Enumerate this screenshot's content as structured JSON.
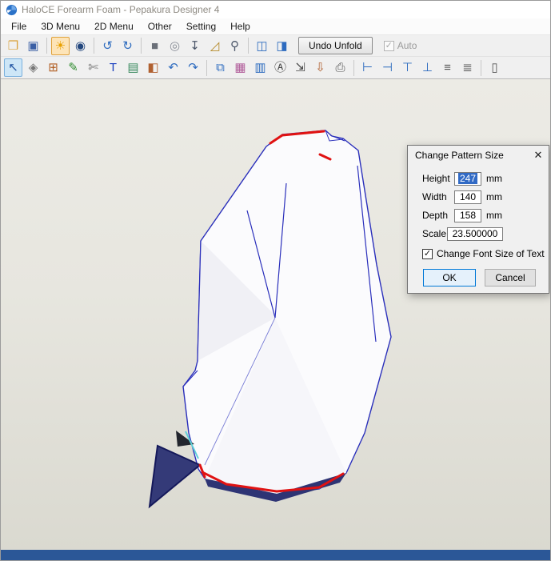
{
  "titlebar": {
    "title": "HaloCE Forearm Foam - Pepakura Designer 4"
  },
  "menubar": {
    "items": [
      {
        "label": "File",
        "name": "menu-file"
      },
      {
        "label": "3D Menu",
        "name": "menu-3d"
      },
      {
        "label": "2D Menu",
        "name": "menu-2d"
      },
      {
        "label": "Other",
        "name": "menu-other"
      },
      {
        "label": "Setting",
        "name": "menu-setting"
      },
      {
        "label": "Help",
        "name": "menu-help"
      }
    ]
  },
  "toolbar1": {
    "icons": [
      {
        "name": "open-folder-icon",
        "glyph": "❒",
        "color": "#d9a23c"
      },
      {
        "name": "save-icon",
        "glyph": "▣",
        "color": "#3a5fa5"
      },
      {
        "sep": true
      },
      {
        "name": "light-toggle-icon",
        "glyph": "☀",
        "color": "#e8a000",
        "cls": "on-orange"
      },
      {
        "name": "texture-view-icon",
        "glyph": "◉",
        "color": "#23477e"
      },
      {
        "sep": true
      },
      {
        "name": "rotate-left-icon",
        "glyph": "↺",
        "color": "#2d6bbf"
      },
      {
        "name": "rotate-right-icon",
        "glyph": "↻",
        "color": "#2d6bbf"
      },
      {
        "sep": true
      },
      {
        "name": "cube-view-icon",
        "glyph": "■",
        "color": "#6a6f78"
      },
      {
        "name": "cylinder-view-icon",
        "glyph": "◎",
        "color": "#8a8f98"
      },
      {
        "name": "plumb-icon",
        "glyph": "↧",
        "color": "#4a5568"
      },
      {
        "name": "ruler-icon",
        "glyph": "◿",
        "color": "#b58a2a"
      },
      {
        "name": "zoom-icon",
        "glyph": "⚲",
        "color": "#4a5568"
      },
      {
        "sep": true
      },
      {
        "name": "split-view-icon",
        "glyph": "◫",
        "color": "#2d6bbf"
      },
      {
        "name": "single-pane-icon",
        "glyph": "◨",
        "color": "#2d6bbf"
      }
    ],
    "button": {
      "label": "Undo Unfold"
    },
    "auto": {
      "label": "Auto",
      "check": "✓"
    }
  },
  "toolbar2": {
    "icons": [
      {
        "name": "select-tool-icon",
        "glyph": "↖",
        "color": "#1c4fa0",
        "cls": "on-blue"
      },
      {
        "name": "edge-tool-icon",
        "glyph": "◈",
        "color": "#777777"
      },
      {
        "name": "arrange-parts-icon",
        "glyph": "⊞",
        "color": "#b05c20"
      },
      {
        "name": "pen-tool-icon",
        "glyph": "✎",
        "color": "#2e8b2e"
      },
      {
        "name": "knife-tool-icon",
        "glyph": "✄",
        "color": "#767676"
      },
      {
        "name": "text-tool-icon",
        "glyph": "T",
        "color": "#1a3fbf"
      },
      {
        "name": "image-tool-icon",
        "glyph": "▤",
        "color": "#3a8a5f"
      },
      {
        "name": "box-tool-icon",
        "glyph": "◧",
        "color": "#b06030"
      },
      {
        "name": "undo-icon",
        "glyph": "↶",
        "color": "#2d6bbf"
      },
      {
        "name": "redo-icon",
        "glyph": "↷",
        "color": "#2d6bbf"
      },
      {
        "sep": true
      },
      {
        "name": "book-view-icon",
        "glyph": "⧉",
        "color": "#2d6bbf"
      },
      {
        "name": "texture-image-icon",
        "glyph": "▦",
        "color": "#b05c9a"
      },
      {
        "name": "chart-icon",
        "glyph": "▥",
        "color": "#2d6bbf"
      },
      {
        "name": "page-text-icon",
        "glyph": "Ⓐ",
        "color": "#444444"
      },
      {
        "name": "page-export-icon",
        "glyph": "⇲",
        "color": "#444444"
      },
      {
        "name": "box-export-icon",
        "glyph": "⇩",
        "color": "#b06030"
      },
      {
        "name": "printer-icon",
        "glyph": "⎙",
        "color": "#555555"
      },
      {
        "sep": true
      },
      {
        "name": "align-left-icon",
        "glyph": "⊢",
        "color": "#2d6bbf"
      },
      {
        "name": "align-right-icon",
        "glyph": "⊣",
        "color": "#2d6bbf"
      },
      {
        "name": "align-top-icon",
        "glyph": "⊤",
        "color": "#2d6bbf"
      },
      {
        "name": "align-bottom-icon",
        "glyph": "⊥",
        "color": "#2d6bbf"
      },
      {
        "name": "align-center-icon",
        "glyph": "≡",
        "color": "#555555"
      },
      {
        "name": "distribute-icon",
        "glyph": "≣",
        "color": "#555555"
      },
      {
        "sep": true
      },
      {
        "name": "page-divider-icon",
        "glyph": "▯",
        "color": "#555555"
      }
    ]
  },
  "dialog": {
    "title": "Change Pattern Size",
    "close": "✕",
    "fields": [
      {
        "name": "field-height",
        "label": "Height",
        "value": "247",
        "unit": "mm",
        "cls": "selected"
      },
      {
        "name": "field-width",
        "label": "Width",
        "value": "140",
        "unit": "mm"
      },
      {
        "name": "field-depth",
        "label": "Depth",
        "value": "158",
        "unit": "mm"
      },
      {
        "name": "field-scale",
        "label": "Scale",
        "value": "23.500000",
        "unit": "",
        "cls": "wide"
      }
    ],
    "checkbox": {
      "label": "Change Font Size of Text",
      "glyph": "✓",
      "checked": true
    },
    "buttons": [
      {
        "name": "ok-button",
        "label": "OK",
        "cls": "default"
      },
      {
        "name": "cancel-button",
        "label": "Cancel"
      }
    ]
  },
  "colors": {
    "selection_blue": "#316ac5",
    "edge_blue": "#2a2fbb",
    "cut_red": "#e01212",
    "taskbar_blue": "#2b5797"
  }
}
